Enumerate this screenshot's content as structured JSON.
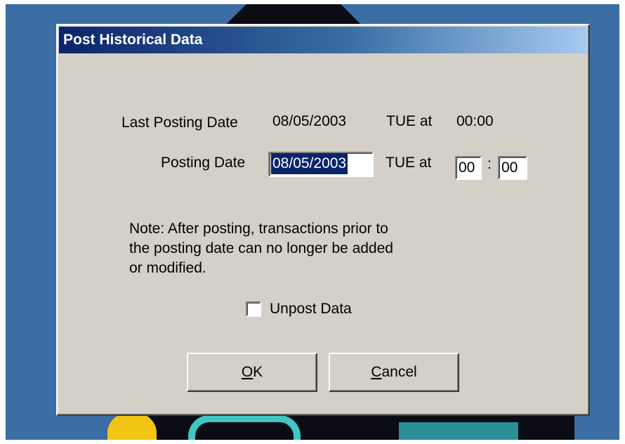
{
  "dialog": {
    "title": "Post Historical Data",
    "last_posting": {
      "label": "Last Posting Date",
      "date": "08/05/2003",
      "day_at": "TUE at",
      "time": "00:00"
    },
    "posting": {
      "label": "Posting Date",
      "date_value": "08/05/2003",
      "day_at": "TUE at",
      "hour": "00",
      "separator": ":",
      "minute": "00"
    },
    "note_lines": [
      "Note: After posting, transactions prior to",
      "the posting date can no longer be added",
      "or modified."
    ],
    "unpost": {
      "label": "Unpost Data",
      "checked": false
    },
    "buttons": {
      "ok": {
        "accel": "O",
        "rest": "K"
      },
      "cancel": {
        "accel": "C",
        "rest": "ancel"
      }
    }
  },
  "colors": {
    "desktop": "#3a6ea5",
    "dialog_face": "#d4d0c8",
    "title_start": "#0a246a",
    "title_end": "#a6caf0",
    "selection": "#0a246a"
  }
}
